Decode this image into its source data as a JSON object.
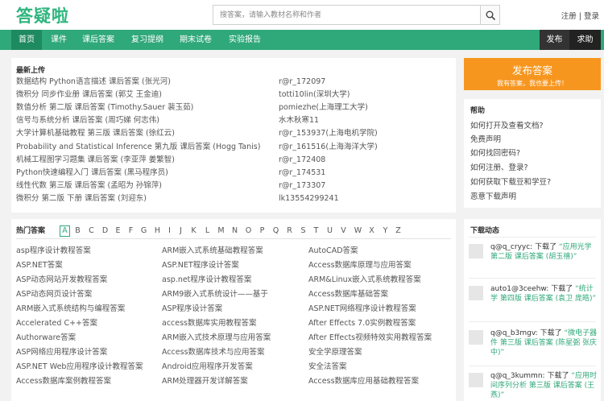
{
  "header": {
    "logo": "答疑啦",
    "search_placeholder": "搜答案，请输入教材名称和作者",
    "login": "注册",
    "sep": "|",
    "register": "登录"
  },
  "nav": {
    "items": [
      "首页",
      "课件",
      "课后答案",
      "复习提纲",
      "期末试卷",
      "实验报告"
    ],
    "right": [
      "发布",
      "求助"
    ]
  },
  "latest": {
    "title": "最新上传",
    "rows": [
      {
        "book": "数据结构 Python语言描述 课后答案 (张光河)",
        "user": "r@r_172097"
      },
      {
        "book": "微积分 同步作业册 课后答案 (郭艾 王金迪)",
        "user": "totti10lin(深圳大学)"
      },
      {
        "book": "数值分析 第二版 课后答案 (Timothy.Sauer 裴玉茹)",
        "user": "pomiezhe(上海理工大学)"
      },
      {
        "book": "信号与系统分析 课后答案 (周巧娣 何志伟)",
        "user": "水木秋寒11"
      },
      {
        "book": "大学计算机基础教程 第三版 课后答案 (徐红云)",
        "user": "r@r_153937(上海电机学院)"
      },
      {
        "book": "Probability and Statistical Inference 第九版 课后答案 (Hogg Tanis)",
        "user": "r@r_161516(上海海洋大学)"
      },
      {
        "book": "机械工程图学习题集 课后答案 (李亚萍 姜繁智)",
        "user": "r@r_172408"
      },
      {
        "book": "Python快速编程入门 课后答案 (黑马程序员)",
        "user": "r@r_174531"
      },
      {
        "book": "线性代数 第三版 课后答案 (孟昭为 孙锦萍)",
        "user": "r@r_173307"
      },
      {
        "book": "微积分 第二版 下册 课后答案 (刘迎东)",
        "user": "lk13554299241"
      }
    ]
  },
  "publish": {
    "title": "发布答案",
    "subtitle": "我有答案，我也要上传！"
  },
  "help": {
    "title": "帮助",
    "items": [
      "如何打开及查看文档?",
      "免费声明",
      "如何找回密码?",
      "如何注册、登录?",
      "如何获取下载豆和学豆?",
      "恶意下载声明"
    ]
  },
  "hot": {
    "title": "热门答案",
    "letters": [
      "A",
      "B",
      "C",
      "D",
      "E",
      "F",
      "G",
      "H",
      "I",
      "J",
      "K",
      "L",
      "M",
      "N",
      "O",
      "P",
      "Q",
      "R",
      "S",
      "T",
      "U",
      "V",
      "W",
      "X",
      "Y",
      "Z"
    ],
    "active_letter": "A",
    "col1": [
      "asp程序设计教程答案",
      "ASP.NET答案",
      "ASP动态网站开发教程答案",
      "ASP动态网页设计答案",
      "ARM嵌入式系统结构与编程答案",
      "Accelerated C++答案",
      "Authorware答案",
      "ASP网络应用程序设计答案",
      "ASP.NET Web应用程序设计教程答案",
      "Access数据库案例教程答案"
    ],
    "col2": [
      "ARM嵌入式系统基础教程答案",
      "ASP.NET程序设计答案",
      "asp.net程序设计教程答案",
      "ARM9嵌入式系统设计——基于",
      "ASP程序设计答案",
      "access数据库实用教程答案",
      "ARM嵌入式技术原理与应用答案",
      "Access数据库技术与应用答案",
      "Android应用程序开发答案",
      "ARM处理器开发详解答案"
    ],
    "col3": [
      "AutoCAD答案",
      "Access数据库原理与应用答案",
      "ARM&Linux嵌入式系统教程答案",
      "Access数据库基础答案",
      "ASP.NET网络程序设计教程答案",
      "After Effects 7.0实例教程答案",
      "After Effects视频特效实用教程答案",
      "安全学原理答案",
      "安全法答案",
      "Access数据库应用基础教程答案"
    ]
  },
  "downloads": {
    "title": "下载动态",
    "items": [
      {
        "user": "q@q_cryyc:",
        "action": "下载了",
        "book": "“应用光学 第二版 课后答案 (胡玉禧)”"
      },
      {
        "user": "auto1@3ceehw:",
        "action": "下载了",
        "book": "“统计学 第四版 课后答案 (袁卫 庞皓)”"
      },
      {
        "user": "q@q_b3mgv:",
        "action": "下载了",
        "book": "“微电子器件 第三版 课后答案 (陈星弼 张庆中)”"
      },
      {
        "user": "q@q_3kummn:",
        "action": "下载了",
        "book": "“应用时间序列分析 第三版 课后答案 (王燕)”"
      }
    ]
  },
  "colors": {
    "brand_green": "#2fa87a",
    "nav_active": "#1e8a60",
    "publish_orange": "#f7961f",
    "dark_nav": "#333333"
  }
}
